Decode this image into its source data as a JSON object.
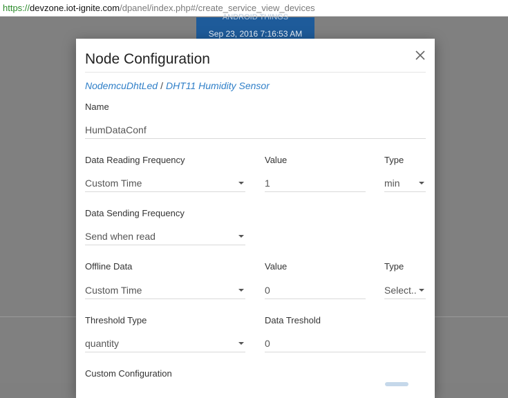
{
  "browser": {
    "url_scheme": "https://",
    "url_host": "devzone.iot-ignite.com",
    "url_path": "/dpanel/index.php#/create_service_view_devices"
  },
  "background": {
    "card_title": "ANDROID THINGS",
    "card_date": "Sep 23, 2016 7:16:53 AM"
  },
  "modal": {
    "title": "Node Configuration",
    "breadcrumb": {
      "node": "NodemcuDhtLed",
      "separator": "/",
      "sensor": "DHT11 Humidity Sensor"
    },
    "name": {
      "label": "Name",
      "value": "HumDataConf"
    },
    "reading": {
      "label": "Data Reading Frequency",
      "value": "Custom Time",
      "value_label": "Value",
      "value_value": "1",
      "type_label": "Type",
      "type_value": "min"
    },
    "sending": {
      "label": "Data Sending Frequency",
      "value": "Send when read"
    },
    "offline": {
      "label": "Offline Data",
      "value": "Custom Time",
      "value_label": "Value",
      "value_value": "0",
      "type_label": "Type",
      "type_value": "Select.."
    },
    "threshold": {
      "label": "Threshold Type",
      "value": "quantity",
      "data_label": "Data Treshold",
      "data_value": "0"
    },
    "custom": {
      "label": "Custom Configuration"
    }
  },
  "colors": {
    "accent": "#2f7fc8",
    "overlay": "#808080",
    "card": "#1e5b9a"
  }
}
